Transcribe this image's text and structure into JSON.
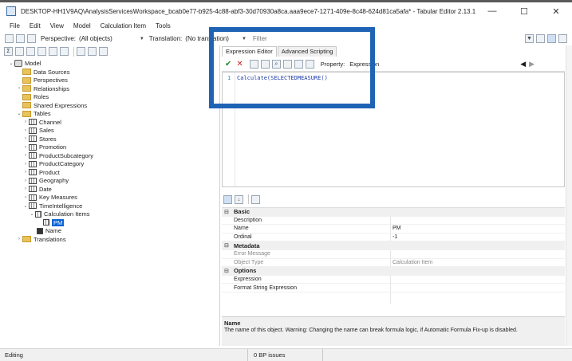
{
  "window": {
    "title": "DESKTOP-HH1V9AQ\\AnalysisServicesWorkspace_bcab0e77-b925-4c88-abf3-30d70930a8ca.aaa9ece7-1271-409e-8c48-624d81ca5afa* - Tabular Editor 2.13.1",
    "min_glyph": "—",
    "max_glyph": "☐",
    "close_glyph": "✕"
  },
  "menu": [
    "File",
    "Edit",
    "View",
    "Model",
    "Calculation Item",
    "Tools"
  ],
  "toolbar": {
    "perspective_label": "Perspective:",
    "perspective_value": "(All objects)",
    "translation_label": "Translation:",
    "translation_value": "(No translation)",
    "filter_placeholder": "Filter"
  },
  "tree": {
    "items": [
      {
        "label": "Model"
      },
      {
        "label": "Data Sources"
      },
      {
        "label": "Perspectives"
      },
      {
        "label": "Relationships"
      },
      {
        "label": "Roles"
      },
      {
        "label": "Shared Expressions"
      },
      {
        "label": "Tables"
      },
      {
        "label": "Channel"
      },
      {
        "label": "Sales"
      },
      {
        "label": "Stores"
      },
      {
        "label": "Promotion"
      },
      {
        "label": "ProductSubcategory"
      },
      {
        "label": "ProductCategory"
      },
      {
        "label": "Product"
      },
      {
        "label": "Geography"
      },
      {
        "label": "Date"
      },
      {
        "label": "Key Measures"
      },
      {
        "label": "TimeIntelligence"
      },
      {
        "label": "Calculation Items"
      },
      {
        "label": "PM"
      },
      {
        "label": "Name"
      },
      {
        "label": "Translations"
      }
    ]
  },
  "editor": {
    "tabs": [
      "Expression Editor",
      "Advanced Scripting"
    ],
    "property_label": "Property:",
    "property_value": "Expression",
    "line_number": "1",
    "code": "Calculate(SELECTEDMEASURE()"
  },
  "properties": {
    "rows": [
      {
        "type": "cat",
        "name": "Basic",
        "toggle": "⊟"
      },
      {
        "type": "prop",
        "name": "Description",
        "value": ""
      },
      {
        "type": "prop",
        "name": "Name",
        "value": "PM"
      },
      {
        "type": "prop",
        "name": "Ordinal",
        "value": "-1"
      },
      {
        "type": "cat",
        "name": "Metadata",
        "toggle": "⊟"
      },
      {
        "type": "prop",
        "name": "Error Message",
        "value": "",
        "grey": true
      },
      {
        "type": "prop",
        "name": "Object Type",
        "value": "Calculation Item",
        "grey": true
      },
      {
        "type": "cat",
        "name": "Options",
        "toggle": "⊟"
      },
      {
        "type": "prop",
        "name": "Expression",
        "value": ""
      },
      {
        "type": "prop",
        "name": "Format String Expression",
        "value": ""
      }
    ],
    "desc_title": "Name",
    "desc_text": "The name of this object. Warning: Changing the name can break formula logic, if Automatic Formula Fix-up is disabled."
  },
  "status": {
    "left": "Editing",
    "bp": "0 BP issues"
  },
  "colors": {
    "highlight": "#1f63b5",
    "selection": "#0a64d6"
  }
}
